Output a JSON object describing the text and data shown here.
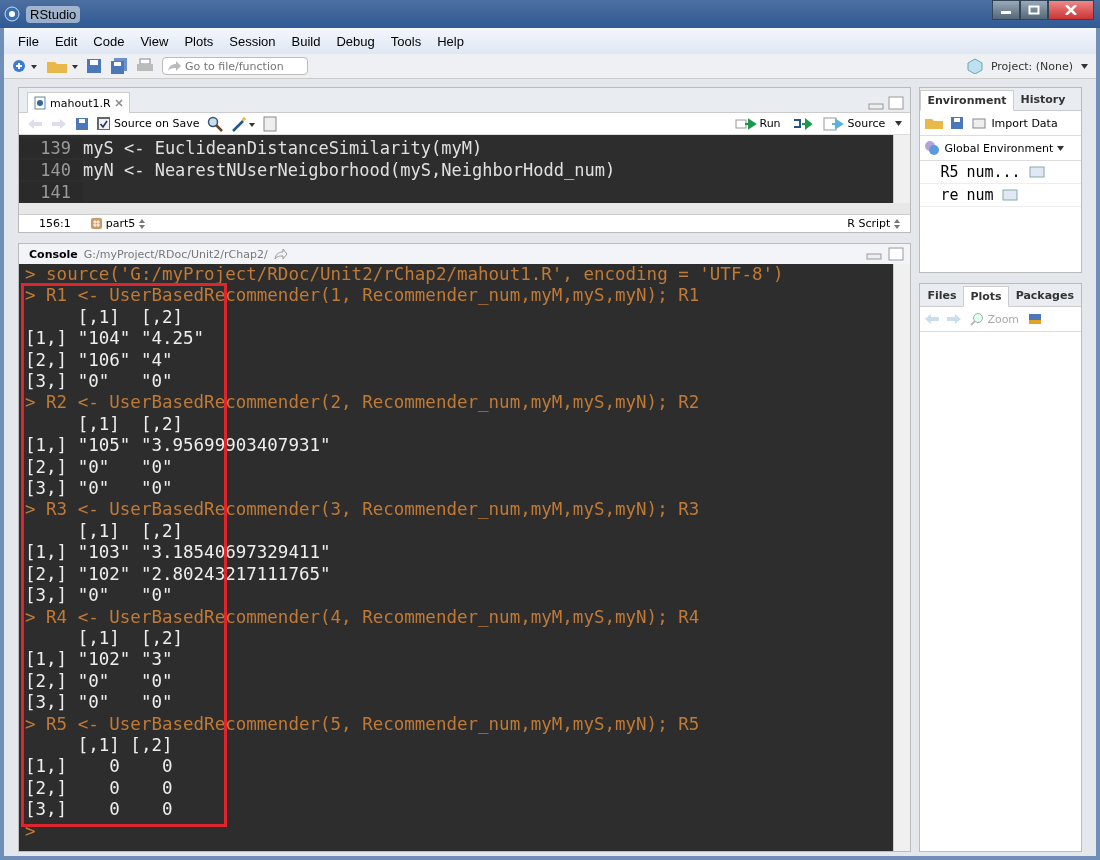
{
  "window": {
    "title": "RStudio"
  },
  "menu": [
    "File",
    "Edit",
    "Code",
    "View",
    "Plots",
    "Session",
    "Build",
    "Debug",
    "Tools",
    "Help"
  ],
  "toolbar": {
    "goto_placeholder": "Go to file/function",
    "project": "Project: (None)"
  },
  "editor": {
    "tab": "mahout1.R",
    "source_on_save": {
      "label": "Source on Save",
      "checked": true
    },
    "run": "Run",
    "source": "Source",
    "lines": [
      {
        "num": "139",
        "code": "myS <- EuclideanDistanceSimilarity(myM)"
      },
      {
        "num": "140",
        "code": "myN <- NearestNUserNeigborhood(myS,NeighborHodd_num)"
      },
      {
        "num": "141"
      }
    ],
    "position": "156:1",
    "section": "part5",
    "file_type": "R Script"
  },
  "console": {
    "title": "Console",
    "path": "G:/myProject/RDoc/Unit2/rChap2/",
    "lines": [
      {
        "kind": "command",
        "text": "> source('G:/myProject/RDoc/Unit2/rChap2/mahout1.R', encoding = 'UTF-8')"
      },
      {
        "kind": "command",
        "text": "> R1 <- UserBasedRecommender(1, Recommender_num,myM,myS,myN); R1"
      },
      {
        "kind": "output",
        "text": "     [,1]  [,2]"
      },
      {
        "kind": "output",
        "text": "[1,] \"104\" \"4.25\""
      },
      {
        "kind": "output",
        "text": "[2,] \"106\" \"4\""
      },
      {
        "kind": "output",
        "text": "[3,] \"0\"   \"0\""
      },
      {
        "kind": "command",
        "text": "> R2 <- UserBasedRecommender(2, Recommender_num,myM,myS,myN); R2"
      },
      {
        "kind": "output",
        "text": "     [,1]  [,2]"
      },
      {
        "kind": "output",
        "text": "[1,] \"105\" \"3.95699903407931\""
      },
      {
        "kind": "output",
        "text": "[2,] \"0\"   \"0\""
      },
      {
        "kind": "output",
        "text": "[3,] \"0\"   \"0\""
      },
      {
        "kind": "command",
        "text": "> R3 <- UserBasedRecommender(3, Recommender_num,myM,myS,myN); R3"
      },
      {
        "kind": "output",
        "text": "     [,1]  [,2]"
      },
      {
        "kind": "output",
        "text": "[1,] \"103\" \"3.18540697329411\""
      },
      {
        "kind": "output",
        "text": "[2,] \"102\" \"2.80243217111765\""
      },
      {
        "kind": "output",
        "text": "[3,] \"0\"   \"0\""
      },
      {
        "kind": "command",
        "text": "> R4 <- UserBasedRecommender(4, Recommender_num,myM,myS,myN); R4"
      },
      {
        "kind": "output",
        "text": "     [,1]  [,2]"
      },
      {
        "kind": "output",
        "text": "[1,] \"102\" \"3\""
      },
      {
        "kind": "output",
        "text": "[2,] \"0\"   \"0\""
      },
      {
        "kind": "output",
        "text": "[3,] \"0\"   \"0\""
      },
      {
        "kind": "command",
        "text": "> R5 <- UserBasedRecommender(5, Recommender_num,myM,myS,myN); R5"
      },
      {
        "kind": "output",
        "text": "     [,1] [,2]"
      },
      {
        "kind": "output",
        "text": "[1,]    0    0"
      },
      {
        "kind": "output",
        "text": "[2,]    0    0"
      },
      {
        "kind": "output",
        "text": "[3,]    0    0"
      },
      {
        "kind": "command",
        "text": ">"
      }
    ]
  },
  "environment": {
    "tabs": [
      {
        "label": "Environment",
        "selected": true
      },
      {
        "label": "History",
        "selected": false
      }
    ],
    "import": "Import Data",
    "scope": "Global Environment",
    "rows": [
      {
        "name": "R5",
        "value": "num..."
      },
      {
        "name": "re",
        "value": "num"
      }
    ]
  },
  "files": {
    "tabs": [
      {
        "label": "Files",
        "selected": false
      },
      {
        "label": "Plots",
        "selected": true
      },
      {
        "label": "Packages",
        "selected": false
      }
    ],
    "zoom": "Zoom"
  }
}
